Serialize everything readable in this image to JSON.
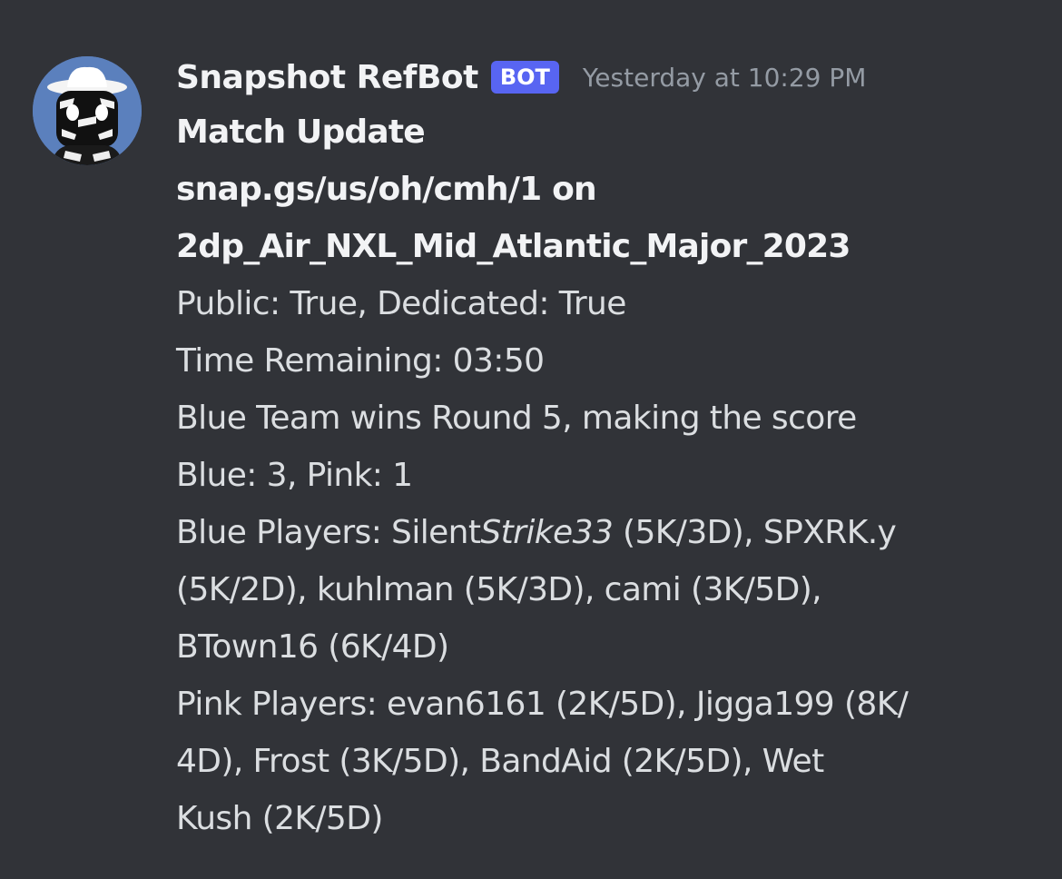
{
  "message": {
    "author": "Snapshot RefBot",
    "badge": "BOT",
    "timestamp": "Yesterday at 10:29 PM",
    "title": "Match Update",
    "server_line1": "snap.gs/us/oh/cmh/1 on",
    "server_line2": "2dp_Air_NXL_Mid_Atlantic_Major_2023",
    "public_line": "Public: True, Dedicated: True",
    "time_line": "Time Remaining: 03:50",
    "result_line1": "Blue Team wins Round 5, making the score",
    "result_line2": "Blue: 3, Pink: 1",
    "blue_l1_prefix": "Blue Players: Silent",
    "blue_l1_italic": "Strike33",
    "blue_l1_suffix": " (5K/3D), SPXRK.y",
    "blue_l2": "(5K/2D), kuhlman (5K/3D), cami (3K/5D),",
    "blue_l3": "BTown16 (6K/4D)",
    "pink_l1": "Pink Players: evan6161 (2K/5D), Jigga199 (8K/",
    "pink_l2": "4D), Frost (3K/5D), BandAid (2K/5D), Wet",
    "pink_l3": "Kush (2K/5D)"
  },
  "colors": {
    "background": "#313338",
    "bot_badge": "#5865f2",
    "text": "#dbdee1",
    "timestamp": "#949ba4"
  },
  "icons": {
    "avatar": "zebra-cowboy-avatar"
  }
}
